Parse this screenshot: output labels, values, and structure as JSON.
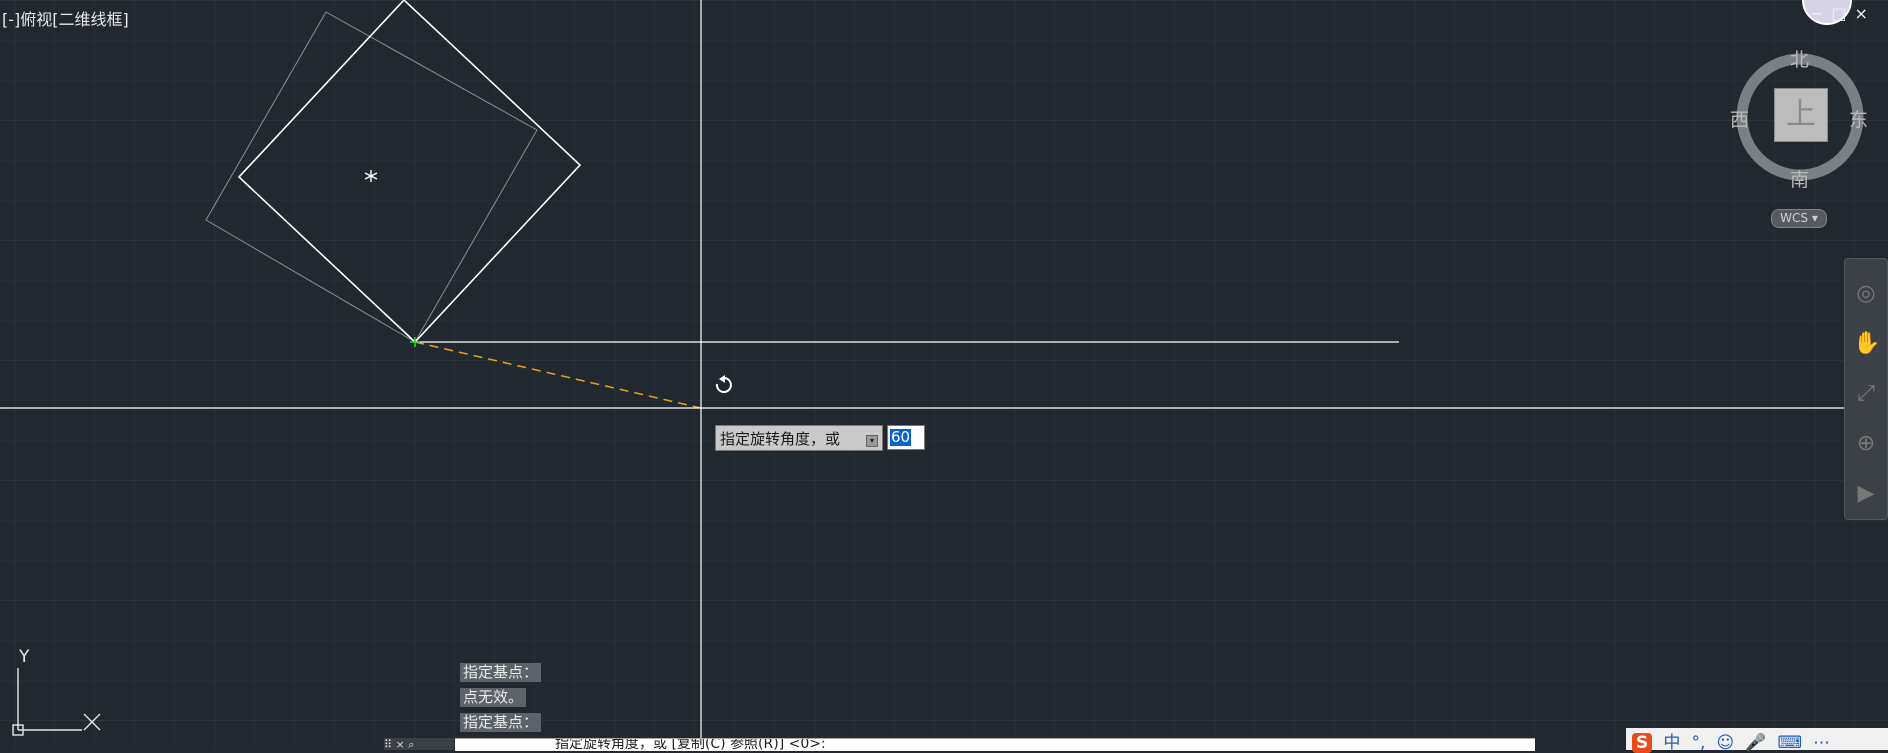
{
  "viewport": {
    "label": "[-]俯视[二维线框]"
  },
  "viewcube": {
    "top_face": "上",
    "north": "北",
    "south": "南",
    "east": "东",
    "west": "西",
    "wcs_label": "WCS ▾"
  },
  "window_buttons": "−□×",
  "dynamic_input": {
    "prompt": "指定旋转角度，或",
    "arrow_icon": "▾",
    "value": "60"
  },
  "command_history": [
    "指定基点：",
    "点无效。",
    "指定基点："
  ],
  "command_line": {
    "grip": "⠿ × ⌕",
    "text": "指定旋转角度，或 [复制(C) 参照(R)] <0>:"
  },
  "ucs": {
    "y_label": "Y"
  },
  "tray": {
    "sogou": "S",
    "lang": "中",
    "punct": "°,",
    "emoji": "☺",
    "mic": "🎤",
    "keyboard": "⌨",
    "more": "⋯"
  },
  "colors": {
    "background": "#212830",
    "geometry": "#ffffff",
    "ghost": "#8a8f95",
    "rubberband": "#e3a21b",
    "accent": "#0a64c8"
  }
}
